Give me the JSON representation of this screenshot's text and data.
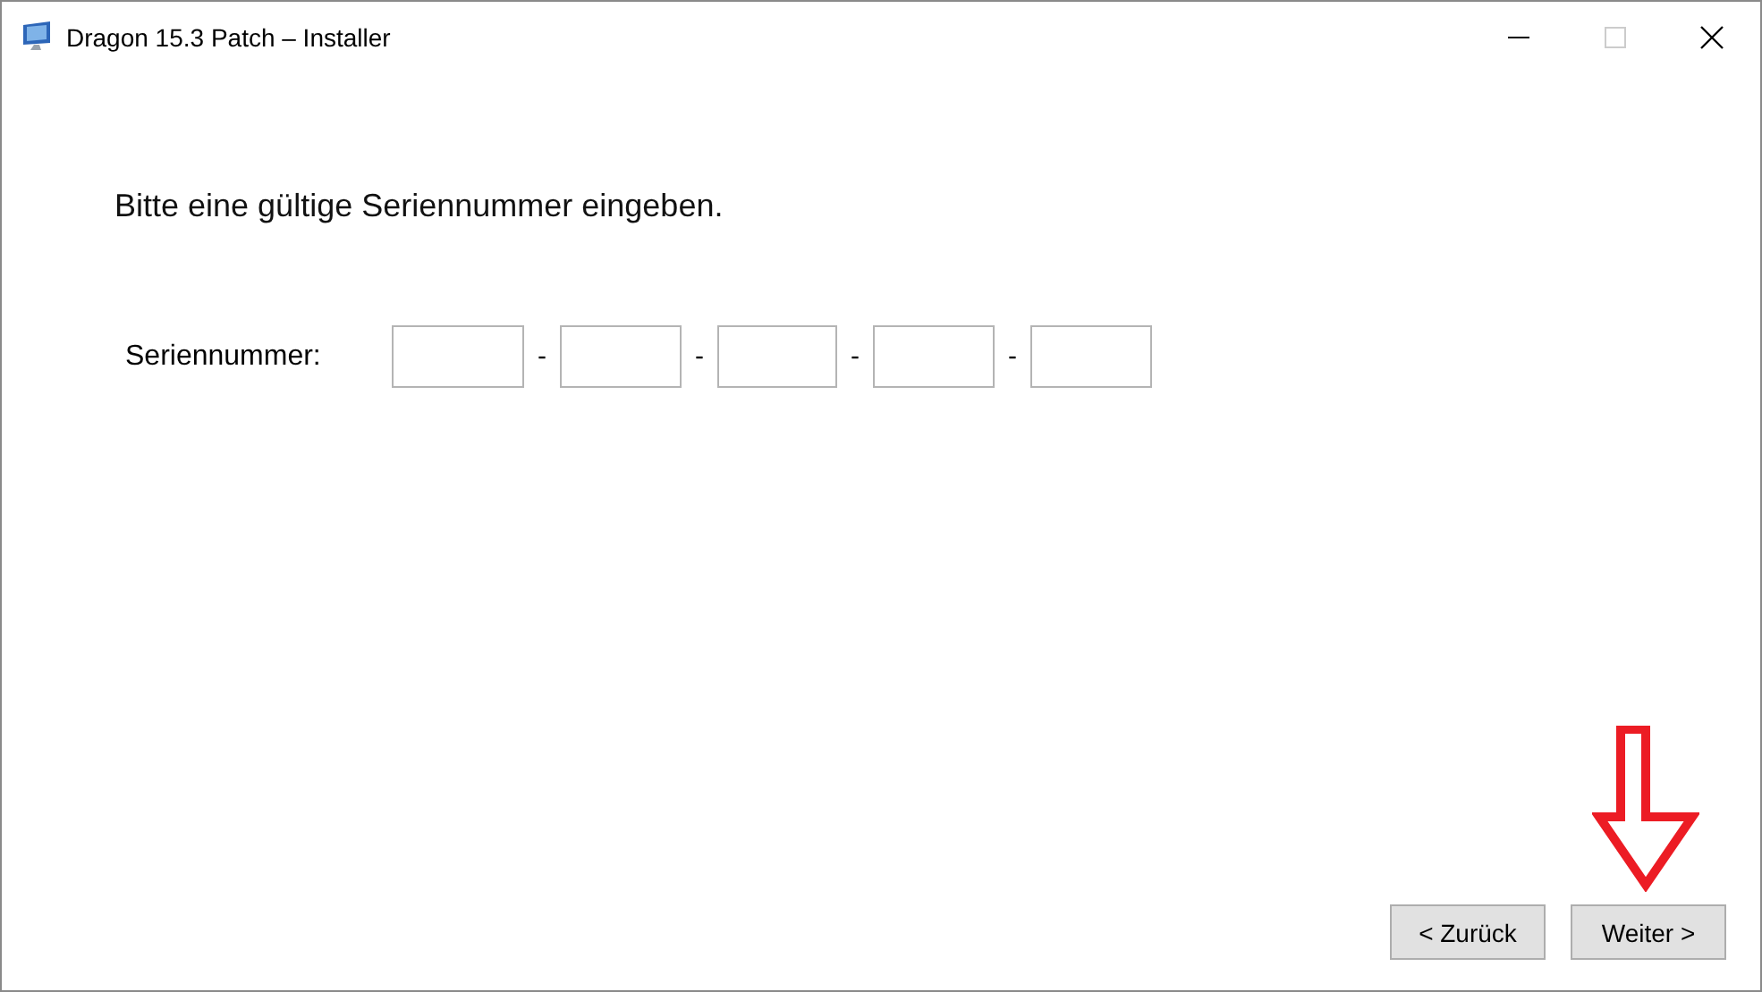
{
  "window": {
    "title": "Dragon 15.3 Patch – Installer",
    "controls": [
      {
        "kind": "minimize",
        "disabled": false
      },
      {
        "kind": "maximize",
        "disabled": true
      },
      {
        "kind": "close",
        "disabled": false
      }
    ]
  },
  "heading": "Bitte eine gültige Seriennummer eingeben.",
  "serial": {
    "label": "Seriennummer:",
    "segments": [
      {
        "kind": "field"
      },
      {
        "kind": "separator",
        "text": "-"
      },
      {
        "kind": "field"
      },
      {
        "kind": "separator",
        "text": "-"
      },
      {
        "kind": "field"
      },
      {
        "kind": "separator",
        "text": "-"
      },
      {
        "kind": "field"
      },
      {
        "kind": "separator",
        "text": "-"
      },
      {
        "kind": "field"
      }
    ]
  },
  "buttons": [
    {
      "label": "< Zurück",
      "highlighted": false
    },
    {
      "label": "Weiter >",
      "highlighted": true
    }
  ]
}
